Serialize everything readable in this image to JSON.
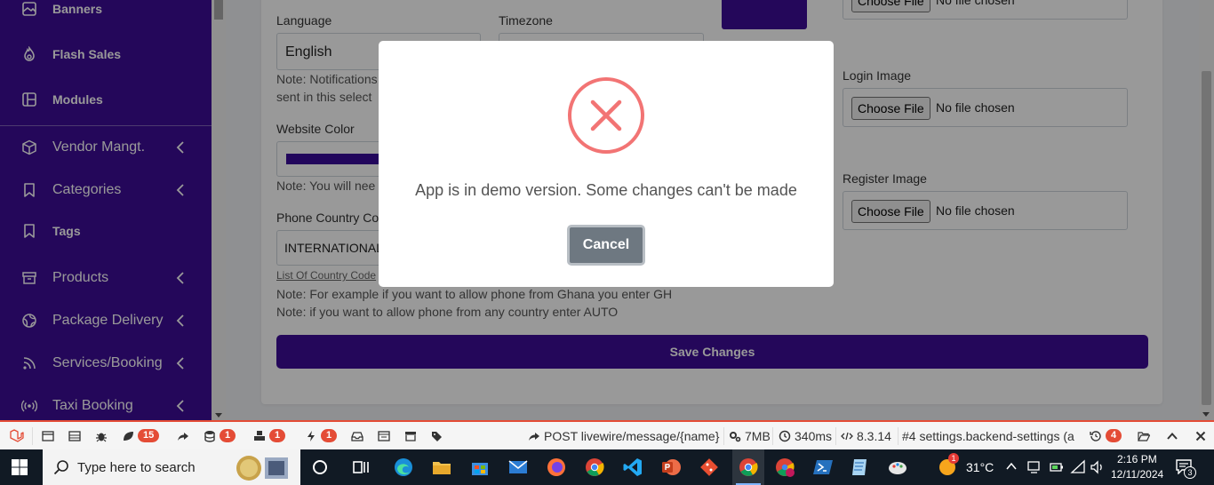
{
  "sidebar": {
    "items": [
      {
        "label": "Banners",
        "icon": "image-icon",
        "style": "bold"
      },
      {
        "label": "Flash Sales",
        "icon": "flame-icon",
        "style": "bold"
      },
      {
        "label": "Modules",
        "icon": "modules-icon",
        "style": "bold"
      },
      {
        "label": "Vendor Mangt.",
        "icon": "box-icon",
        "style": "reg",
        "chevron": true
      },
      {
        "label": "Categories",
        "icon": "bookmark-icon",
        "style": "reg",
        "chevron": true
      },
      {
        "label": "Tags",
        "icon": "bookmark-icon",
        "style": "bold"
      },
      {
        "label": "Products",
        "icon": "archive-icon",
        "style": "reg",
        "chevron": true
      },
      {
        "label": "Package Delivery",
        "icon": "globe-icon",
        "style": "reg",
        "chevron": true
      },
      {
        "label": "Services/Booking",
        "icon": "rss-icon",
        "style": "reg",
        "chevron": true
      },
      {
        "label": "Taxi Booking",
        "icon": "broadcast-icon",
        "style": "reg",
        "chevron": true
      }
    ]
  },
  "form": {
    "language_label": "Language",
    "language_value": "English",
    "timezone_label": "Timezone",
    "language_note_1": "Note: Notifications",
    "language_note_2": "sent in this select",
    "website_color_label": "Website Color",
    "website_color_value": "#3a0a99",
    "website_color_note": "Note: You will nee",
    "phone_country_label": "Phone Country Co",
    "phone_country_value": "INTERNATIONAL",
    "country_codes_link": "List Of Country Code",
    "phone_note_1": "Note: For example if you want to allow phone from Ghana you enter GH",
    "phone_note_2": "Note: if you want to allow phone from any country enter AUTO",
    "login_image_label": "Login Image",
    "register_image_label": "Register Image",
    "choose_file_label": "Choose File",
    "no_file_text": "No file chosen",
    "save_label": "Save Changes"
  },
  "modal": {
    "message": "App is in demo version. Some changes can't be made",
    "cancel_label": "Cancel",
    "icon": "error-x-icon",
    "icon_color": "#f27474"
  },
  "debugbar": {
    "requests_count": "15",
    "queries_count": "1",
    "models_count": "1",
    "events_count": "1",
    "request": "POST livewire/message/{name}",
    "memory": "7MB",
    "time": "340ms",
    "php_version": "8.3.14",
    "route": "#4 settings.backend-settings (a",
    "history_count": "4"
  },
  "taskbar": {
    "search_placeholder": "Type here to search",
    "weather": "31°C",
    "weather_badge": "1",
    "time": "2:16 PM",
    "date": "12/11/2024",
    "notification_count": "3"
  },
  "colors": {
    "brand": "#3d0d96",
    "debugbar_accent": "#e44c36",
    "modal_cancel": "#6e7881"
  }
}
